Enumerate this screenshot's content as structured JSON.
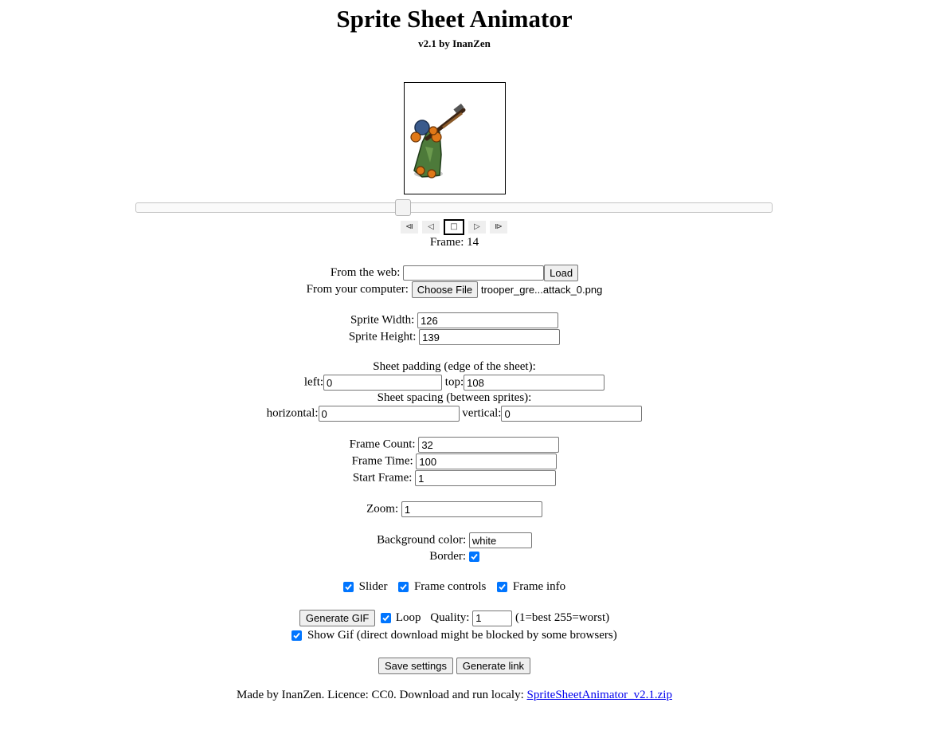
{
  "header": {
    "title": "Sprite Sheet Animator",
    "subtitle": "v2.1 by InanZen"
  },
  "player": {
    "slider": {
      "value_frame": 14,
      "max_frames": 32
    },
    "controls": {
      "first": "⧏",
      "prev": "◁",
      "stop": "□",
      "play": "▷",
      "last": "⧐"
    },
    "frame_prefix": "Frame: ",
    "frame_value": "14"
  },
  "source": {
    "web_label": "From the web:",
    "web_value": "",
    "load_label": "Load",
    "computer_label": "From your computer:",
    "choose_label": "Choose File",
    "file_name": "trooper_gre...attack_0.png"
  },
  "sprite": {
    "width_label": "Sprite Width:",
    "width_value": "126",
    "height_label": "Sprite Height:",
    "height_value": "139"
  },
  "padding": {
    "title": "Sheet padding (edge of the sheet):",
    "left_label": "left:",
    "left_value": "0",
    "top_label": "top:",
    "top_value": "108"
  },
  "spacing": {
    "title": "Sheet spacing (between sprites):",
    "horizontal_label": "horizontal:",
    "horizontal_value": "0",
    "vertical_label": "vertical:",
    "vertical_value": "0"
  },
  "frames": {
    "count_label": "Frame Count:",
    "count_value": "32",
    "time_label": "Frame Time:",
    "time_value": "100",
    "start_label": "Start Frame:",
    "start_value": "1"
  },
  "zoom": {
    "label": "Zoom:",
    "value": "1"
  },
  "appearance": {
    "bg_label": "Background color:",
    "bg_value": "white",
    "border_label": "Border:",
    "border_checked": true
  },
  "display": {
    "slider_label": "Slider",
    "frame_controls_label": "Frame controls",
    "frame_info_label": "Frame info"
  },
  "gif": {
    "generate_label": "Generate GIF",
    "loop_label": "Loop",
    "quality_label": "Quality:",
    "quality_value": "1",
    "quality_hint": "(1=best 255=worst)",
    "show_gif_label": "Show Gif (direct download might be blocked by some browsers)"
  },
  "actions": {
    "save_label": "Save settings",
    "link_label": "Generate link"
  },
  "footer": {
    "text": "Made by InanZen. Licence: CC0. Download and run localy: ",
    "link_text": "SpriteSheetAnimator_v2.1.zip"
  },
  "colors": {
    "checkbox": "#0075ff",
    "link": "#0000ee",
    "sprite_coat": "#4d7a3a",
    "sprite_helmet": "#3a5a8c",
    "sprite_skin": "#e07818"
  }
}
